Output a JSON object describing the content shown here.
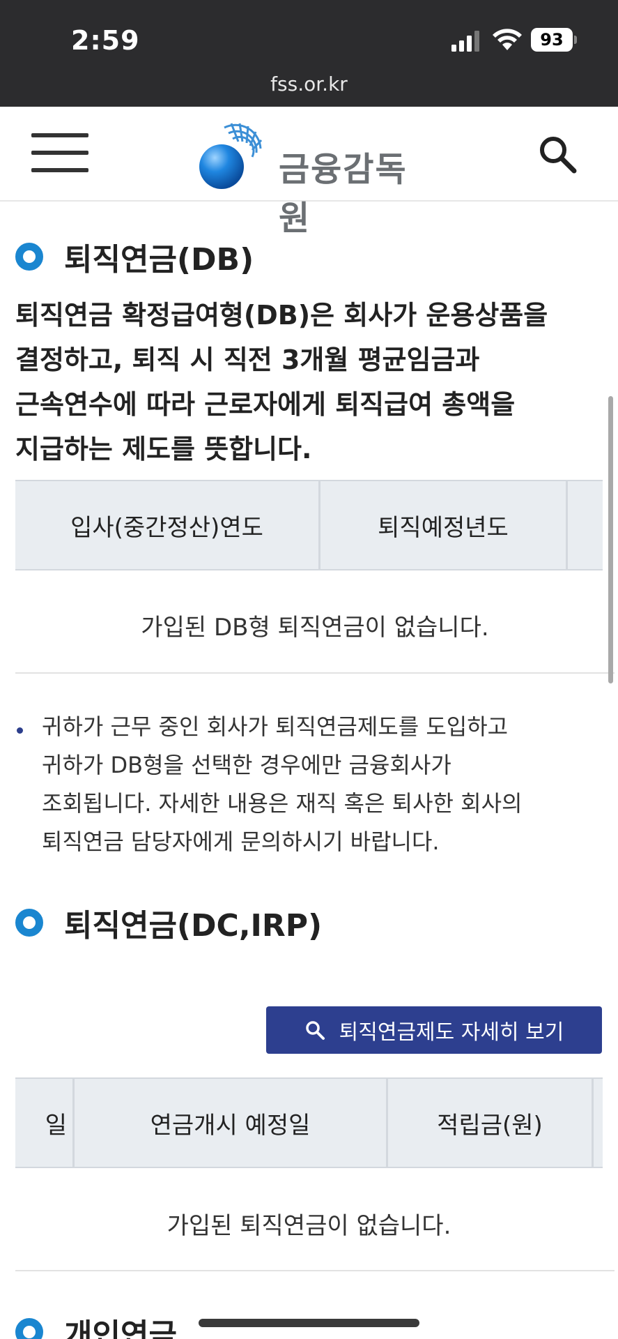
{
  "status_bar": {
    "time": "2:59",
    "battery": "93",
    "url": "fss.or.kr"
  },
  "header": {
    "logo_text": "금융감독원"
  },
  "sections": {
    "db": {
      "title": "퇴직연금(DB)",
      "description": [
        "퇴직연금 확정급여형(DB)은 회사가 운용상품을",
        "결정하고, 퇴직 시 직전 3개월 평균임금과",
        "근속연수에 따라 근로자에게 퇴직급여 총액을",
        "지급하는 제도를 뜻합니다."
      ],
      "table": {
        "columns": [
          "입사(중간정산)연도",
          "퇴직예정년도",
          ""
        ],
        "empty_message": "가입된 DB형 퇴직연금이 없습니다."
      },
      "note": [
        "귀하가 근무 중인 회사가 퇴직연금제도를 도입하고",
        "귀하가 DB형을 선택한 경우에만 금융회사가",
        "조회됩니다. 자세한 내용은 재직 혹은 퇴사한 회사의",
        "퇴직연금 담당자에게 문의하시기 바랍니다."
      ]
    },
    "dc": {
      "title": "퇴직연금(DC,IRP)",
      "detail_button": "퇴직연금제도 자세히 보기",
      "table": {
        "columns": [
          "일",
          "연금개시 예정일",
          "적립금(원)",
          ""
        ],
        "empty_message": "가입된 퇴직연금이 없습니다."
      }
    },
    "personal": {
      "title": "개인연금"
    }
  },
  "colors": {
    "accent": "#1a86d0",
    "button": "#2d3f8f",
    "table_header": "#e9edf1"
  }
}
